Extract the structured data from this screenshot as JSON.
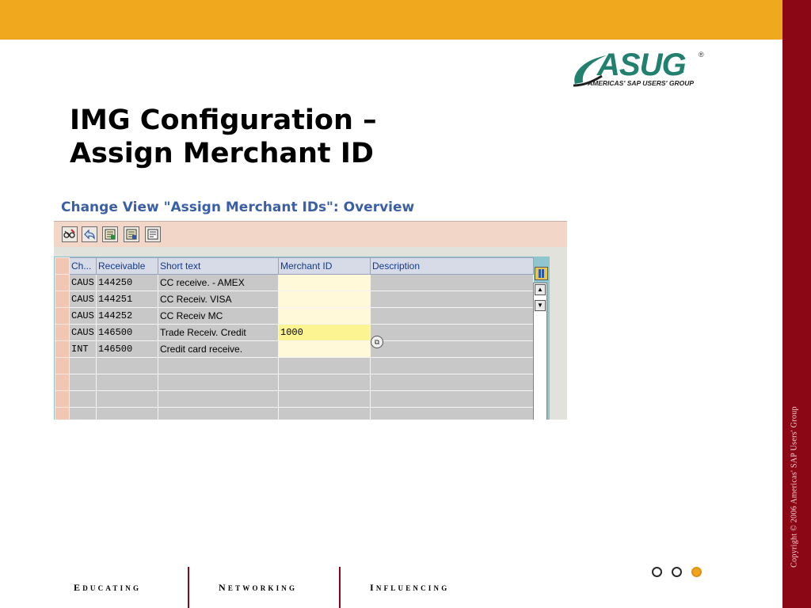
{
  "slide": {
    "title_line1": "IMG Configuration –",
    "title_line2": "Assign Merchant ID",
    "logo_text": "ASUG",
    "logo_registered": "®",
    "logo_subtitle": "AMERICAS' SAP USERS' GROUP",
    "copyright": "Copyright © 2006 Americas' SAP Users' Group",
    "footer": [
      "Educating",
      "Networking",
      "Influencing"
    ],
    "nav_dots": 3,
    "active_dot": 3
  },
  "sap": {
    "heading": "Change View \"Assign Merchant IDs\": Overview",
    "toolbar_icons": [
      "change-glasses-icon",
      "undo-icon",
      "select-all-icon",
      "select-block-icon",
      "deselect-all-icon"
    ],
    "columns": [
      "Ch...",
      "Receivable",
      "Short text",
      "Merchant ID",
      "Description"
    ],
    "rows": [
      {
        "ch": "CAUS",
        "receivable": "144250",
        "short_text": "CC receive. -  AMEX",
        "merchant_id": "",
        "description": ""
      },
      {
        "ch": "CAUS",
        "receivable": "144251",
        "short_text": "CC Receiv. VISA",
        "merchant_id": "",
        "description": ""
      },
      {
        "ch": "CAUS",
        "receivable": "144252",
        "short_text": "CC Receiv MC",
        "merchant_id": "",
        "description": ""
      },
      {
        "ch": "CAUS",
        "receivable": "146500",
        "short_text": "Trade Receiv. Credit",
        "merchant_id": "1000",
        "description": ""
      },
      {
        "ch": "INT",
        "receivable": "146500",
        "short_text": "Credit card receive.",
        "merchant_id": "",
        "description": ""
      }
    ],
    "empty_rows": 4,
    "active_row": 4,
    "colors": {
      "toolbar_bg": "#f2d6c8",
      "header_text": "#123a8a",
      "active_input": "#fcf490",
      "accent_orange": "#f0a91f",
      "accent_red": "#8b0716",
      "logo_green": "#22806e"
    }
  }
}
